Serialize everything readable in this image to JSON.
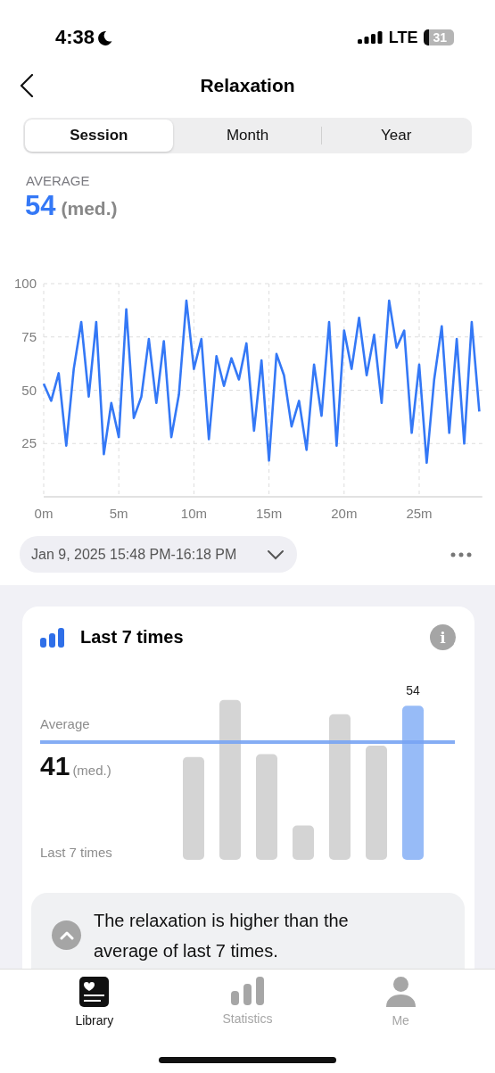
{
  "status_bar": {
    "time": "4:38",
    "network": "LTE",
    "battery": "31"
  },
  "header": {
    "title": "Relaxation"
  },
  "tabs": [
    {
      "label": "Session",
      "selected": true
    },
    {
      "label": "Month",
      "selected": false
    },
    {
      "label": "Year",
      "selected": false
    }
  ],
  "summary": {
    "label": "AVERAGE",
    "value": "54",
    "unit": "(med.)"
  },
  "session_chart": {
    "chart_data": {
      "type": "line",
      "grid": true,
      "xlim": [
        0,
        29.2
      ],
      "ylim": [
        0,
        100
      ],
      "yticks": [
        25,
        50,
        75,
        100
      ],
      "xticks": [
        {
          "value": 0,
          "label": "0m"
        },
        {
          "value": 5,
          "label": "5m"
        },
        {
          "value": 10,
          "label": "10m"
        },
        {
          "value": 15,
          "label": "15m"
        },
        {
          "value": 20,
          "label": "20m"
        },
        {
          "value": 25,
          "label": "25m"
        }
      ],
      "x": [
        0,
        0.5,
        1,
        1.5,
        2,
        2.5,
        3,
        3.5,
        4,
        4.5,
        5,
        5.5,
        6,
        6.5,
        7,
        7.5,
        8,
        8.5,
        9,
        9.5,
        10,
        10.5,
        11,
        11.5,
        12,
        12.5,
        13,
        13.5,
        14,
        14.5,
        15,
        15.5,
        16,
        16.5,
        17,
        17.5,
        18,
        18.5,
        19,
        19.5,
        20,
        20.5,
        21,
        21.5,
        22,
        22.5,
        23,
        23.5,
        24,
        24.5,
        25,
        25.5,
        26,
        26.5,
        27,
        27.5,
        28,
        28.5,
        29
      ],
      "series": [
        {
          "color": "#3478f6",
          "values": [
            53,
            45,
            58,
            24,
            60,
            82,
            47,
            82,
            20,
            44,
            28,
            88,
            37,
            47,
            74,
            44,
            73,
            28,
            48,
            92,
            60,
            74,
            27,
            66,
            52,
            65,
            55,
            72,
            31,
            64,
            17,
            67,
            57,
            33,
            45,
            22,
            62,
            38,
            82,
            24,
            78,
            60,
            84,
            57,
            76,
            44,
            92,
            70,
            78,
            30,
            62,
            16,
            55,
            80,
            30,
            74,
            25,
            82,
            40
          ]
        }
      ]
    }
  },
  "session_picker": {
    "value": "Jan 9, 2025 15:48 PM-16:18 PM"
  },
  "card": {
    "title": "Last 7 times",
    "average_label": "Average",
    "average_value": "41",
    "average_unit": "(med.)",
    "axis_label": "Last 7 times",
    "info_button": "i",
    "latest_label": "54",
    "message": {
      "text": "The relaxation is higher than the average of last 7 times.",
      "expanded": true
    }
  },
  "nav": [
    {
      "label": "Library",
      "selected": true,
      "kind": "library"
    },
    {
      "label": "Statistics",
      "selected": false,
      "kind": "statistics"
    },
    {
      "label": "Me",
      "selected": false,
      "kind": "me"
    }
  ]
}
